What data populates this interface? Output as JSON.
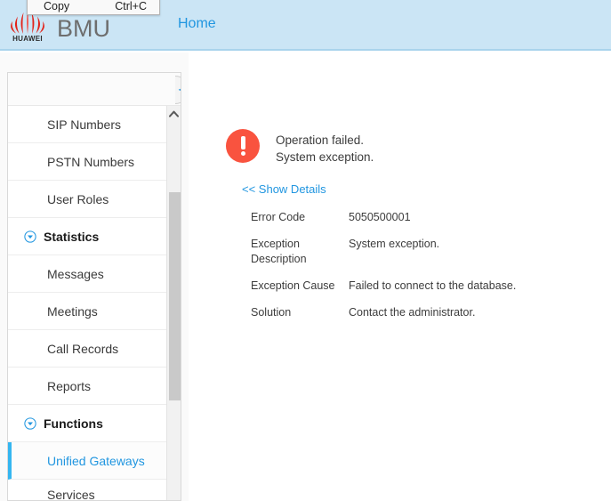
{
  "header": {
    "logo_name": "huawei-logo",
    "logo_text": "HUAWEI",
    "app_title": "BMU",
    "tabs": [
      {
        "label": "Home",
        "name": "tab-home"
      }
    ],
    "background_color": "#cbe5f5",
    "accent_color": "#2196e0"
  },
  "context_menu": {
    "items": [
      {
        "label": "Copy",
        "shortcut": "Ctrl+C"
      }
    ]
  },
  "sidebar": {
    "collapse_icon": "chevron-left-icon",
    "scroll_up_icon": "chevron-up-icon",
    "items": [
      {
        "label": "SIP Numbers",
        "type": "item",
        "name": "sidebar-item-sip-numbers"
      },
      {
        "label": "PSTN Numbers",
        "type": "item",
        "name": "sidebar-item-pstn-numbers"
      },
      {
        "label": "User Roles",
        "type": "item",
        "name": "sidebar-item-user-roles"
      },
      {
        "label": "Statistics",
        "type": "group",
        "name": "sidebar-group-statistics"
      },
      {
        "label": "Messages",
        "type": "item",
        "name": "sidebar-item-messages"
      },
      {
        "label": "Meetings",
        "type": "item",
        "name": "sidebar-item-meetings"
      },
      {
        "label": "Call Records",
        "type": "item",
        "name": "sidebar-item-call-records"
      },
      {
        "label": "Reports",
        "type": "item",
        "name": "sidebar-item-reports"
      },
      {
        "label": "Functions",
        "type": "group",
        "name": "sidebar-group-functions"
      },
      {
        "label": "Unified Gateways",
        "type": "item",
        "active": true,
        "name": "sidebar-item-unified-gateways"
      },
      {
        "label": "Services",
        "type": "item",
        "name": "sidebar-item-services"
      }
    ]
  },
  "main": {
    "error": {
      "icon": "error-exclamation-icon",
      "line1": "Operation failed.",
      "line2": "System exception.",
      "icon_color": "#f9533f"
    },
    "show_details_label": "<< Show Details",
    "details": [
      {
        "key": "Error Code",
        "value": "5050500001"
      },
      {
        "key": "Exception Description",
        "value": "System exception."
      },
      {
        "key": "Exception Cause",
        "value": "Failed to connect to the database."
      },
      {
        "key": "Solution",
        "value": "Contact the administrator."
      }
    ]
  }
}
